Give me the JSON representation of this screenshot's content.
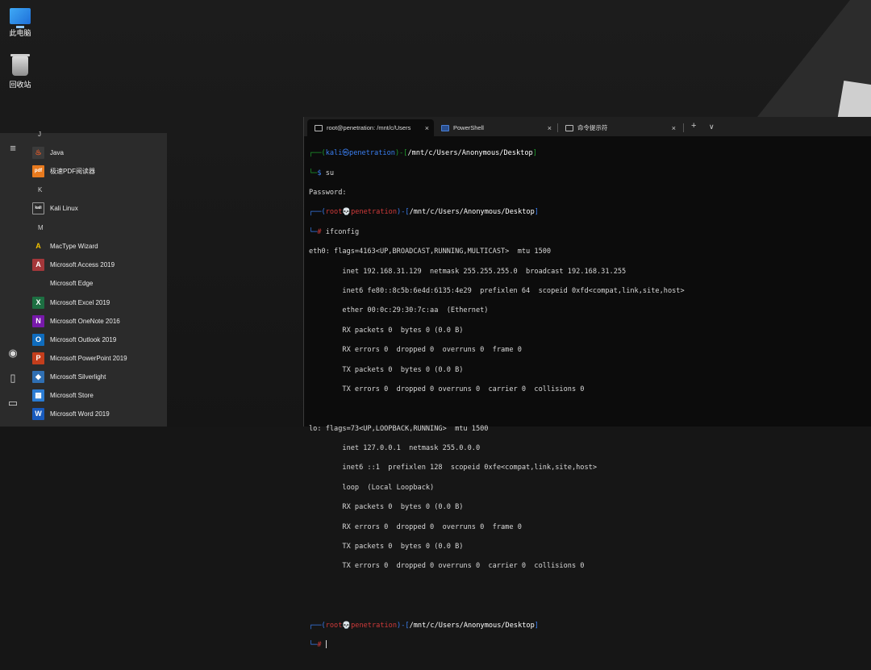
{
  "desktop": {
    "icons": [
      {
        "label": "此电脑",
        "icon": "computer-icon"
      },
      {
        "label": "回收站",
        "icon": "recycle-bin-icon"
      }
    ]
  },
  "start_menu": {
    "rail_icons": [
      "hamburger-menu-icon",
      "user-icon",
      "document-icon",
      "pictures-icon"
    ],
    "letters": {
      "j": "J",
      "k": "K",
      "m": "M"
    },
    "apps": [
      {
        "label": "Java",
        "icon_text": "♨",
        "color": "#3b3b3b"
      },
      {
        "label": "极速PDF阅读器",
        "icon_text": "pdf",
        "color": "#e87a1e"
      },
      {
        "label": "Kali Linux",
        "icon_text": "kali",
        "color": "#2b2b2b"
      },
      {
        "label": "MacType Wizard",
        "icon_text": "A",
        "color": "#2b2b2b"
      },
      {
        "label": "Microsoft Access 2019",
        "icon_text": "A",
        "color": "#a4373a"
      },
      {
        "label": "Microsoft Edge",
        "icon_text": "",
        "color": "#2b2b2b"
      },
      {
        "label": "Microsoft Excel 2019",
        "icon_text": "X",
        "color": "#1d6f42"
      },
      {
        "label": "Microsoft OneNote 2016",
        "icon_text": "N",
        "color": "#7719aa"
      },
      {
        "label": "Microsoft Outlook 2019",
        "icon_text": "O",
        "color": "#0f6cbd"
      },
      {
        "label": "Microsoft PowerPoint 2019",
        "icon_text": "P",
        "color": "#c43e1c"
      },
      {
        "label": "Microsoft Silverlight",
        "icon_text": "◆",
        "color": "#2f6fb3"
      },
      {
        "label": "Microsoft Store",
        "icon_text": "▦",
        "color": "#2b7cd3"
      },
      {
        "label": "Microsoft Word 2019",
        "icon_text": "W",
        "color": "#185abd"
      }
    ]
  },
  "terminal": {
    "tabs": [
      {
        "label": "root@penetration: /mnt/c/Users",
        "close": "×"
      },
      {
        "label": "PowerShell",
        "close": "×"
      },
      {
        "label": "命令提示符",
        "close": "×"
      }
    ],
    "new_tab": "+",
    "dropdown": "∨",
    "prompt_user_line": {
      "user": "kali",
      "at": "㉿",
      "host": "penetration",
      "path": "/mnt/c/Users/Anonymous/Desktop"
    },
    "cmd_su": "su",
    "password_line": "Password:",
    "prompt_root": {
      "user": "root",
      "skull": "💀",
      "host": "penetration",
      "path": "/mnt/c/Users/Anonymous/Desktop"
    },
    "cmd_ifconfig": "ifconfig",
    "output": [
      "eth0: flags=4163<UP,BROADCAST,RUNNING,MULTICAST>  mtu 1500",
      "        inet 192.168.31.129  netmask 255.255.255.0  broadcast 192.168.31.255",
      "        inet6 fe80::8c5b:6e4d:6135:4e29  prefixlen 64  scopeid 0xfd<compat,link,site,host>",
      "        ether 00:0c:29:30:7c:aa  (Ethernet)",
      "        RX packets 0  bytes 0 (0.0 B)",
      "        RX errors 0  dropped 0  overruns 0  frame 0",
      "        TX packets 0  bytes 0 (0.0 B)",
      "        TX errors 0  dropped 0 overruns 0  carrier 0  collisions 0",
      "",
      "lo: flags=73<UP,LOOPBACK,RUNNING>  mtu 1500",
      "        inet 127.0.0.1  netmask 255.0.0.0",
      "        inet6 ::1  prefixlen 128  scopeid 0xfe<compat,link,site,host>",
      "        loop  (Local Loopback)",
      "        RX packets 0  bytes 0 (0.0 B)",
      "        RX errors 0  dropped 0  overruns 0  frame 0",
      "        TX packets 0  bytes 0 (0.0 B)",
      "        TX errors 0  dropped 0 overruns 0  carrier 0  collisions 0",
      "",
      ""
    ],
    "prompt_symbol_user": "$",
    "prompt_symbol_root": "#"
  }
}
